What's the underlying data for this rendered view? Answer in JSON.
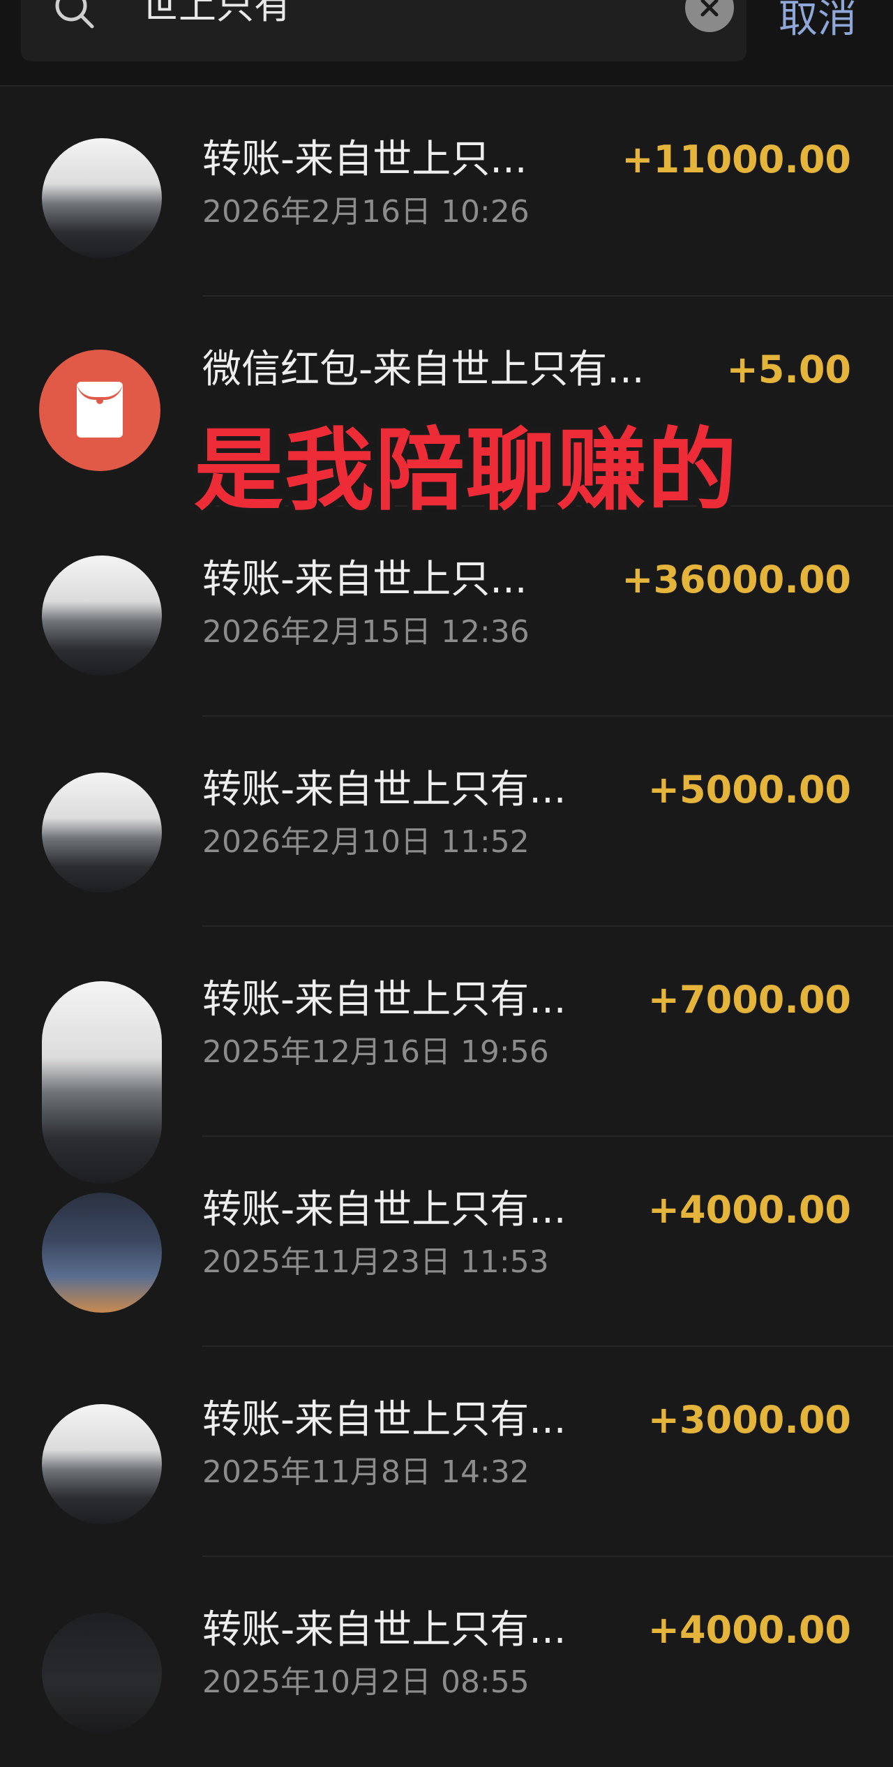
{
  "search": {
    "query": "世上只有",
    "cancel_label": "取消"
  },
  "colors": {
    "background": "#191919",
    "amount": "#e5b43a",
    "cancel": "#8fa6d8",
    "redpacket": "#e05a47",
    "caption": "#ee2c38"
  },
  "overlay_caption": "是我陪聊赚的",
  "transactions": [
    {
      "title": "转账-来自世上只...",
      "time": "2026年2月16日 10:26",
      "amount": "+11000.00",
      "icon": "avatar"
    },
    {
      "title": "微信红包-来自世上只有...",
      "time": "",
      "amount": "+5.00",
      "icon": "red-packet-icon"
    },
    {
      "title": "转账-来自世上只...",
      "time": "2026年2月15日 12:36",
      "amount": "+36000.00",
      "icon": "avatar"
    },
    {
      "title": "转账-来自世上只有...",
      "time": "2026年2月10日 11:52",
      "amount": "+5000.00",
      "icon": "avatar"
    },
    {
      "title": "转账-来自世上只有...",
      "time": "2025年12月16日 19:56",
      "amount": "+7000.00",
      "icon": "avatar"
    },
    {
      "title": "转账-来自世上只有...",
      "time": "2025年11月23日 11:53",
      "amount": "+4000.00",
      "icon": "avatar"
    },
    {
      "title": "转账-来自世上只有...",
      "time": "2025年11月8日 14:32",
      "amount": "+3000.00",
      "icon": "avatar"
    },
    {
      "title": "转账-来自世上只有...",
      "time": "2025年10月2日 08:55",
      "amount": "+4000.00",
      "icon": "avatar"
    }
  ]
}
